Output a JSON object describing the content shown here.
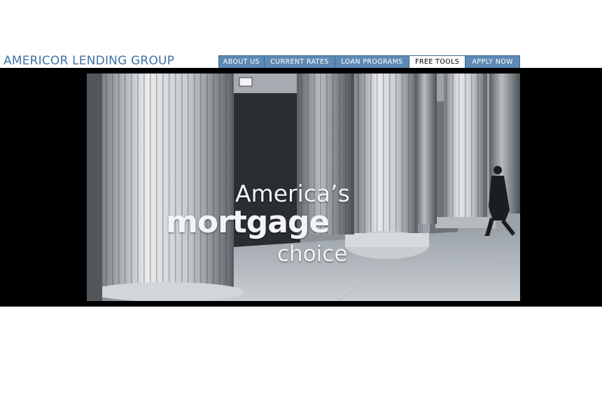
{
  "header": {
    "logo_text": "AMERICOR LENDING GROUP",
    "brand_color": "#3f74a8"
  },
  "nav": {
    "items": [
      {
        "label": "ABOUT US",
        "active": false
      },
      {
        "label": "CURRENT RATES",
        "active": false
      },
      {
        "label": "LOAN PROGRAMS",
        "active": false
      },
      {
        "label": "FREE TOOLS",
        "active": true
      },
      {
        "label": "APPLY NOW",
        "active": false
      }
    ],
    "bar_color": "#5d8ab5"
  },
  "hero": {
    "line1": "America’s",
    "line2": "mortgage",
    "line3": "choice"
  }
}
